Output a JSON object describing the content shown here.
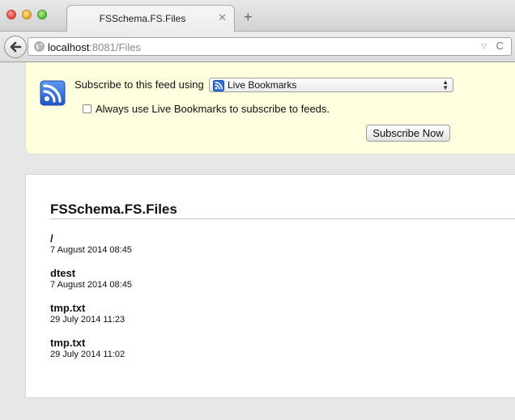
{
  "browser": {
    "tab_title": "FSSchema.FS.Files",
    "tab_close": "✕",
    "new_tab": "+",
    "url_host": "localhost",
    "url_rest": ":8081/Files",
    "url_dropmark": "▽",
    "reload": "C"
  },
  "feed": {
    "subscribe_label": "Subscribe to this feed using",
    "selected_reader": "Live Bookmarks",
    "always_use_label": "Always use Live Bookmarks to subscribe to feeds.",
    "always_use_checked": false,
    "subscribe_button": "Subscribe Now",
    "title": "FSSchema.FS.Files",
    "entries": [
      {
        "title": "/",
        "date": "7 August 2014 08:45"
      },
      {
        "title": "dtest",
        "date": "7 August 2014 08:45"
      },
      {
        "title": "tmp.txt",
        "date": "29 July 2014 11:23"
      },
      {
        "title": "tmp.txt",
        "date": "29 July 2014 11:02"
      }
    ]
  },
  "colors": {
    "feed_header_bg": "#ffffe0",
    "rss_icon_bg": "#2f6fd8"
  },
  "icons": {
    "back": "back-arrow-icon",
    "site": "globe-icon",
    "feed": "rss-feed-icon"
  }
}
